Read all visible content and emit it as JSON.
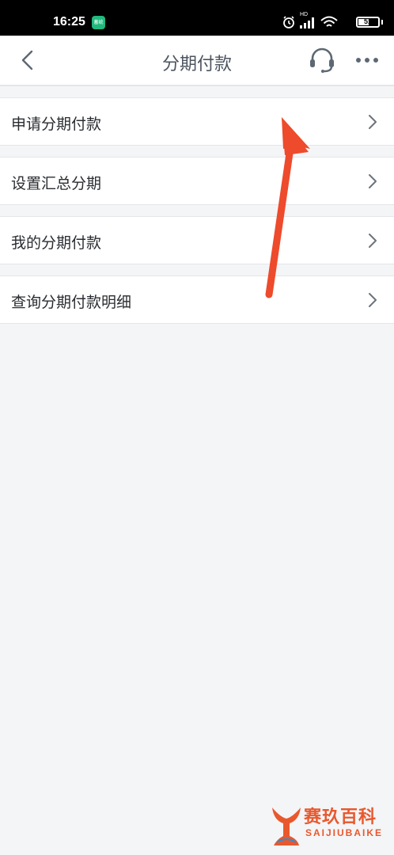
{
  "status_bar": {
    "time": "16:25",
    "app_badge": "蓄统",
    "battery_level": "51",
    "network": "HD"
  },
  "nav": {
    "title": "分期付款",
    "back_icon": "chevron-left-icon",
    "service_icon": "headset-icon",
    "more_icon": "more-dots-icon"
  },
  "menu": {
    "items": [
      {
        "label": "申请分期付款"
      },
      {
        "label": "设置汇总分期"
      },
      {
        "label": "我的分期付款"
      },
      {
        "label": "查询分期付款明细"
      }
    ]
  },
  "watermark": {
    "title": "赛玖百科",
    "subtitle": "SAIJIUBAIKE"
  },
  "colors": {
    "background": "#f4f5f7",
    "annotation_arrow": "#ee4a2c",
    "watermark": "#e9582d"
  }
}
